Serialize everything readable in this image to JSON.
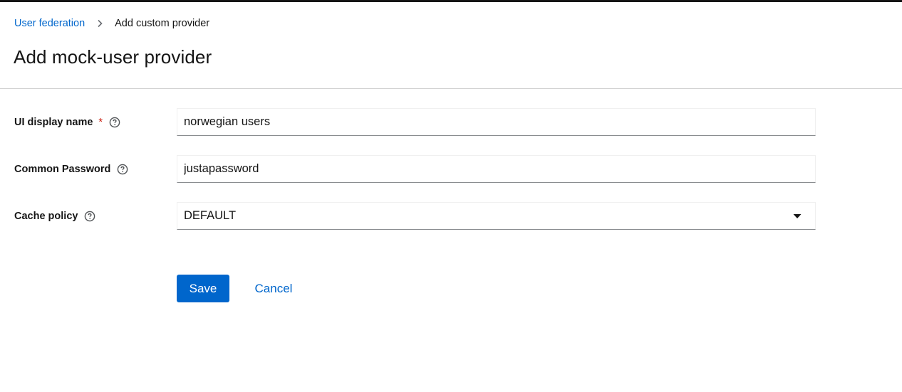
{
  "breadcrumb": {
    "items": [
      {
        "label": "User federation"
      },
      {
        "label": "Add custom provider"
      }
    ]
  },
  "page": {
    "title": "Add mock-user provider"
  },
  "form": {
    "display_name": {
      "label": "UI display name",
      "required_marker": "*",
      "value": "norwegian users"
    },
    "common_password": {
      "label": "Common Password",
      "value": "justapassword"
    },
    "cache_policy": {
      "label": "Cache policy",
      "selected": "DEFAULT"
    }
  },
  "actions": {
    "save_label": "Save",
    "cancel_label": "Cancel"
  },
  "icons": {
    "help": "help-icon",
    "breadcrumb_separator": "chevron-right-icon",
    "dropdown": "caret-down-icon"
  },
  "colors": {
    "link": "#0066cc",
    "primary_button": "#0066cc",
    "required": "#c9190b",
    "text": "#151515",
    "top_bar": "#151515"
  }
}
